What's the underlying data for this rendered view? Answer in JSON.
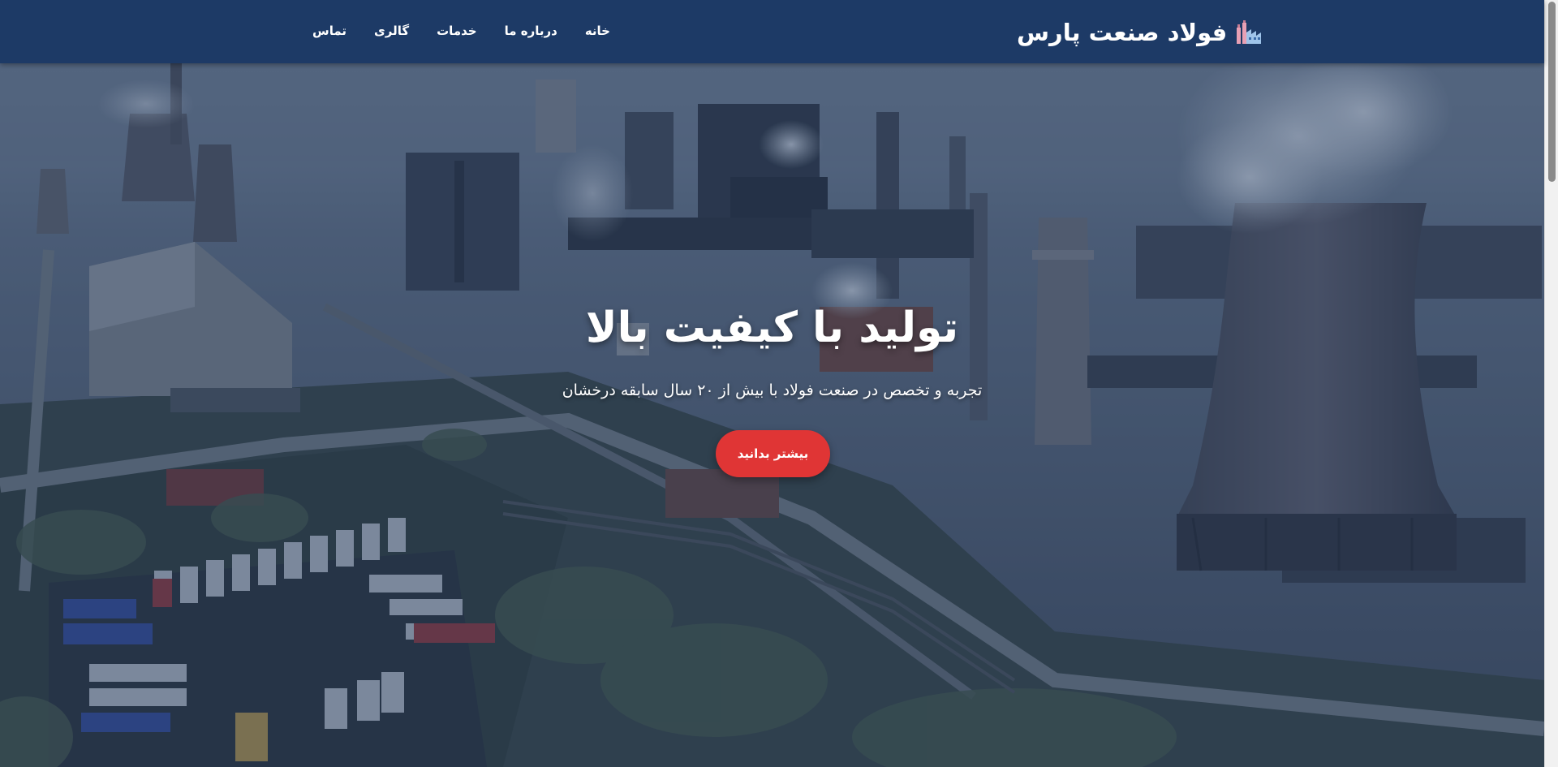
{
  "navbar": {
    "brand": {
      "title": "فولاد صنعت پارس",
      "icon": "factory-icon"
    },
    "links": [
      {
        "label": "خانه"
      },
      {
        "label": "درباره ما"
      },
      {
        "label": "خدمات"
      },
      {
        "label": "گالری"
      },
      {
        "label": "تماس"
      }
    ]
  },
  "hero": {
    "title": "تولید با کیفیت بالا",
    "subtitle": "تجربه و تخصص در صنعت فولاد با بیش از ۲۰ سال سابقه درخشان",
    "cta_label": "بیشتر بدانید",
    "background_image": "steel-plant-aerial-photo"
  },
  "colors": {
    "navbar_bg": "#1d3a66",
    "overlay": "#1d355a",
    "cta": "#e03535",
    "text": "#ffffff"
  }
}
